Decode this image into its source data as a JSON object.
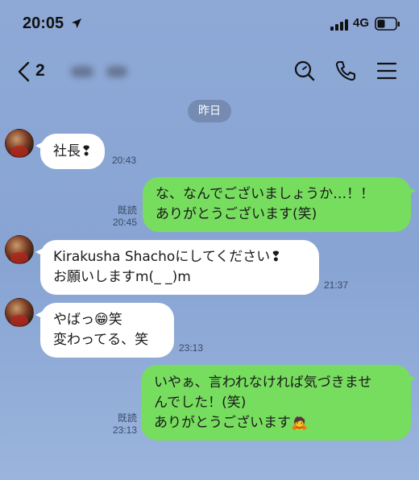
{
  "status_bar": {
    "time": "20:05",
    "network": "4G",
    "icons": [
      "location-arrow-icon",
      "signal-icon",
      "battery-icon"
    ]
  },
  "nav": {
    "back_count": "2",
    "icons": [
      "back-chevron-icon",
      "search-icon",
      "phone-icon",
      "menu-icon"
    ]
  },
  "date_label": "昨日",
  "messages": [
    {
      "side": "in",
      "lines": [
        "社長❢"
      ],
      "time": "20:43"
    },
    {
      "side": "out",
      "lines": [
        "な、なんでございましょうか…！！",
        "ありがとうございます(笑)"
      ],
      "read": "既読",
      "time": "20:45"
    },
    {
      "side": "in",
      "lines": [
        "Kirakusha  Shachoにしてください❢",
        "お願いしますm(_ _)m"
      ],
      "time": "21:37"
    },
    {
      "side": "in",
      "lines": [
        "やばっ😁笑",
        "変わってる、笑"
      ],
      "time": "23:13"
    },
    {
      "side": "out",
      "lines": [
        "いやぁ、言われなければ気づきませ",
        "んでした！(笑)",
        "ありがとうございます🙇"
      ],
      "read": "既読",
      "time": "23:13"
    }
  ],
  "colors": {
    "background": "#8ea9d6",
    "outgoing": "#77dd5f",
    "incoming": "#ffffff"
  }
}
